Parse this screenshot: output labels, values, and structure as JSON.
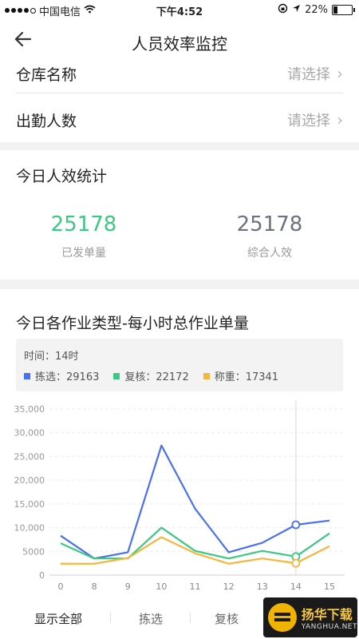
{
  "status_bar": {
    "carrier": "中国电信",
    "time": "下午4:52",
    "battery": "22%",
    "battery_level": 0.22
  },
  "nav": {
    "title": "人员效率监控"
  },
  "form": {
    "warehouse": {
      "label": "仓库名称",
      "placeholder": "请选择"
    },
    "attendance": {
      "label": "出勤人数",
      "placeholder": "请选择"
    }
  },
  "efficiency": {
    "title": "今日人效统计",
    "dispatched": {
      "value": "25178",
      "label": "已发单量"
    },
    "overall": {
      "value": "25178",
      "label": "综合人效"
    }
  },
  "hourly": {
    "title": "今日各作业类型-每小时总作业单量",
    "tooltip": {
      "time_label": "时间：14时",
      "items": [
        {
          "text": "拣选：29163",
          "color": "#4a6ff0"
        },
        {
          "text": "复核：22172",
          "color": "#3cc784"
        },
        {
          "text": "称重：17341",
          "color": "#f5b53f"
        }
      ]
    },
    "tabs": [
      "显示全部",
      "拣选",
      "复核"
    ]
  },
  "chart_data": {
    "type": "line",
    "categories": [
      "0",
      "8",
      "9",
      "10",
      "11",
      "12",
      "13",
      "14",
      "15"
    ],
    "yticks": [
      "0",
      "5000",
      "10,000",
      "15,000",
      "20,000",
      "25,000",
      "30,000",
      "35,000"
    ],
    "ylim": [
      0,
      35000
    ],
    "grid": true,
    "highlight_category": "14",
    "series": [
      {
        "name": "拣选",
        "color": "#4a6ff0",
        "values": [
          8300,
          3500,
          4800,
          27300,
          14000,
          4800,
          6800,
          10600,
          11500
        ]
      },
      {
        "name": "复核",
        "color": "#3cc784",
        "values": [
          6700,
          3500,
          3500,
          10000,
          5100,
          3500,
          5100,
          3900,
          8800
        ]
      },
      {
        "name": "称重",
        "color": "#f5b53f",
        "values": [
          2400,
          2400,
          3600,
          8000,
          4600,
          2400,
          3500,
          2500,
          6100
        ]
      }
    ]
  },
  "watermark": {
    "name": "扬华下载",
    "url": "YANGHUA.NET"
  }
}
